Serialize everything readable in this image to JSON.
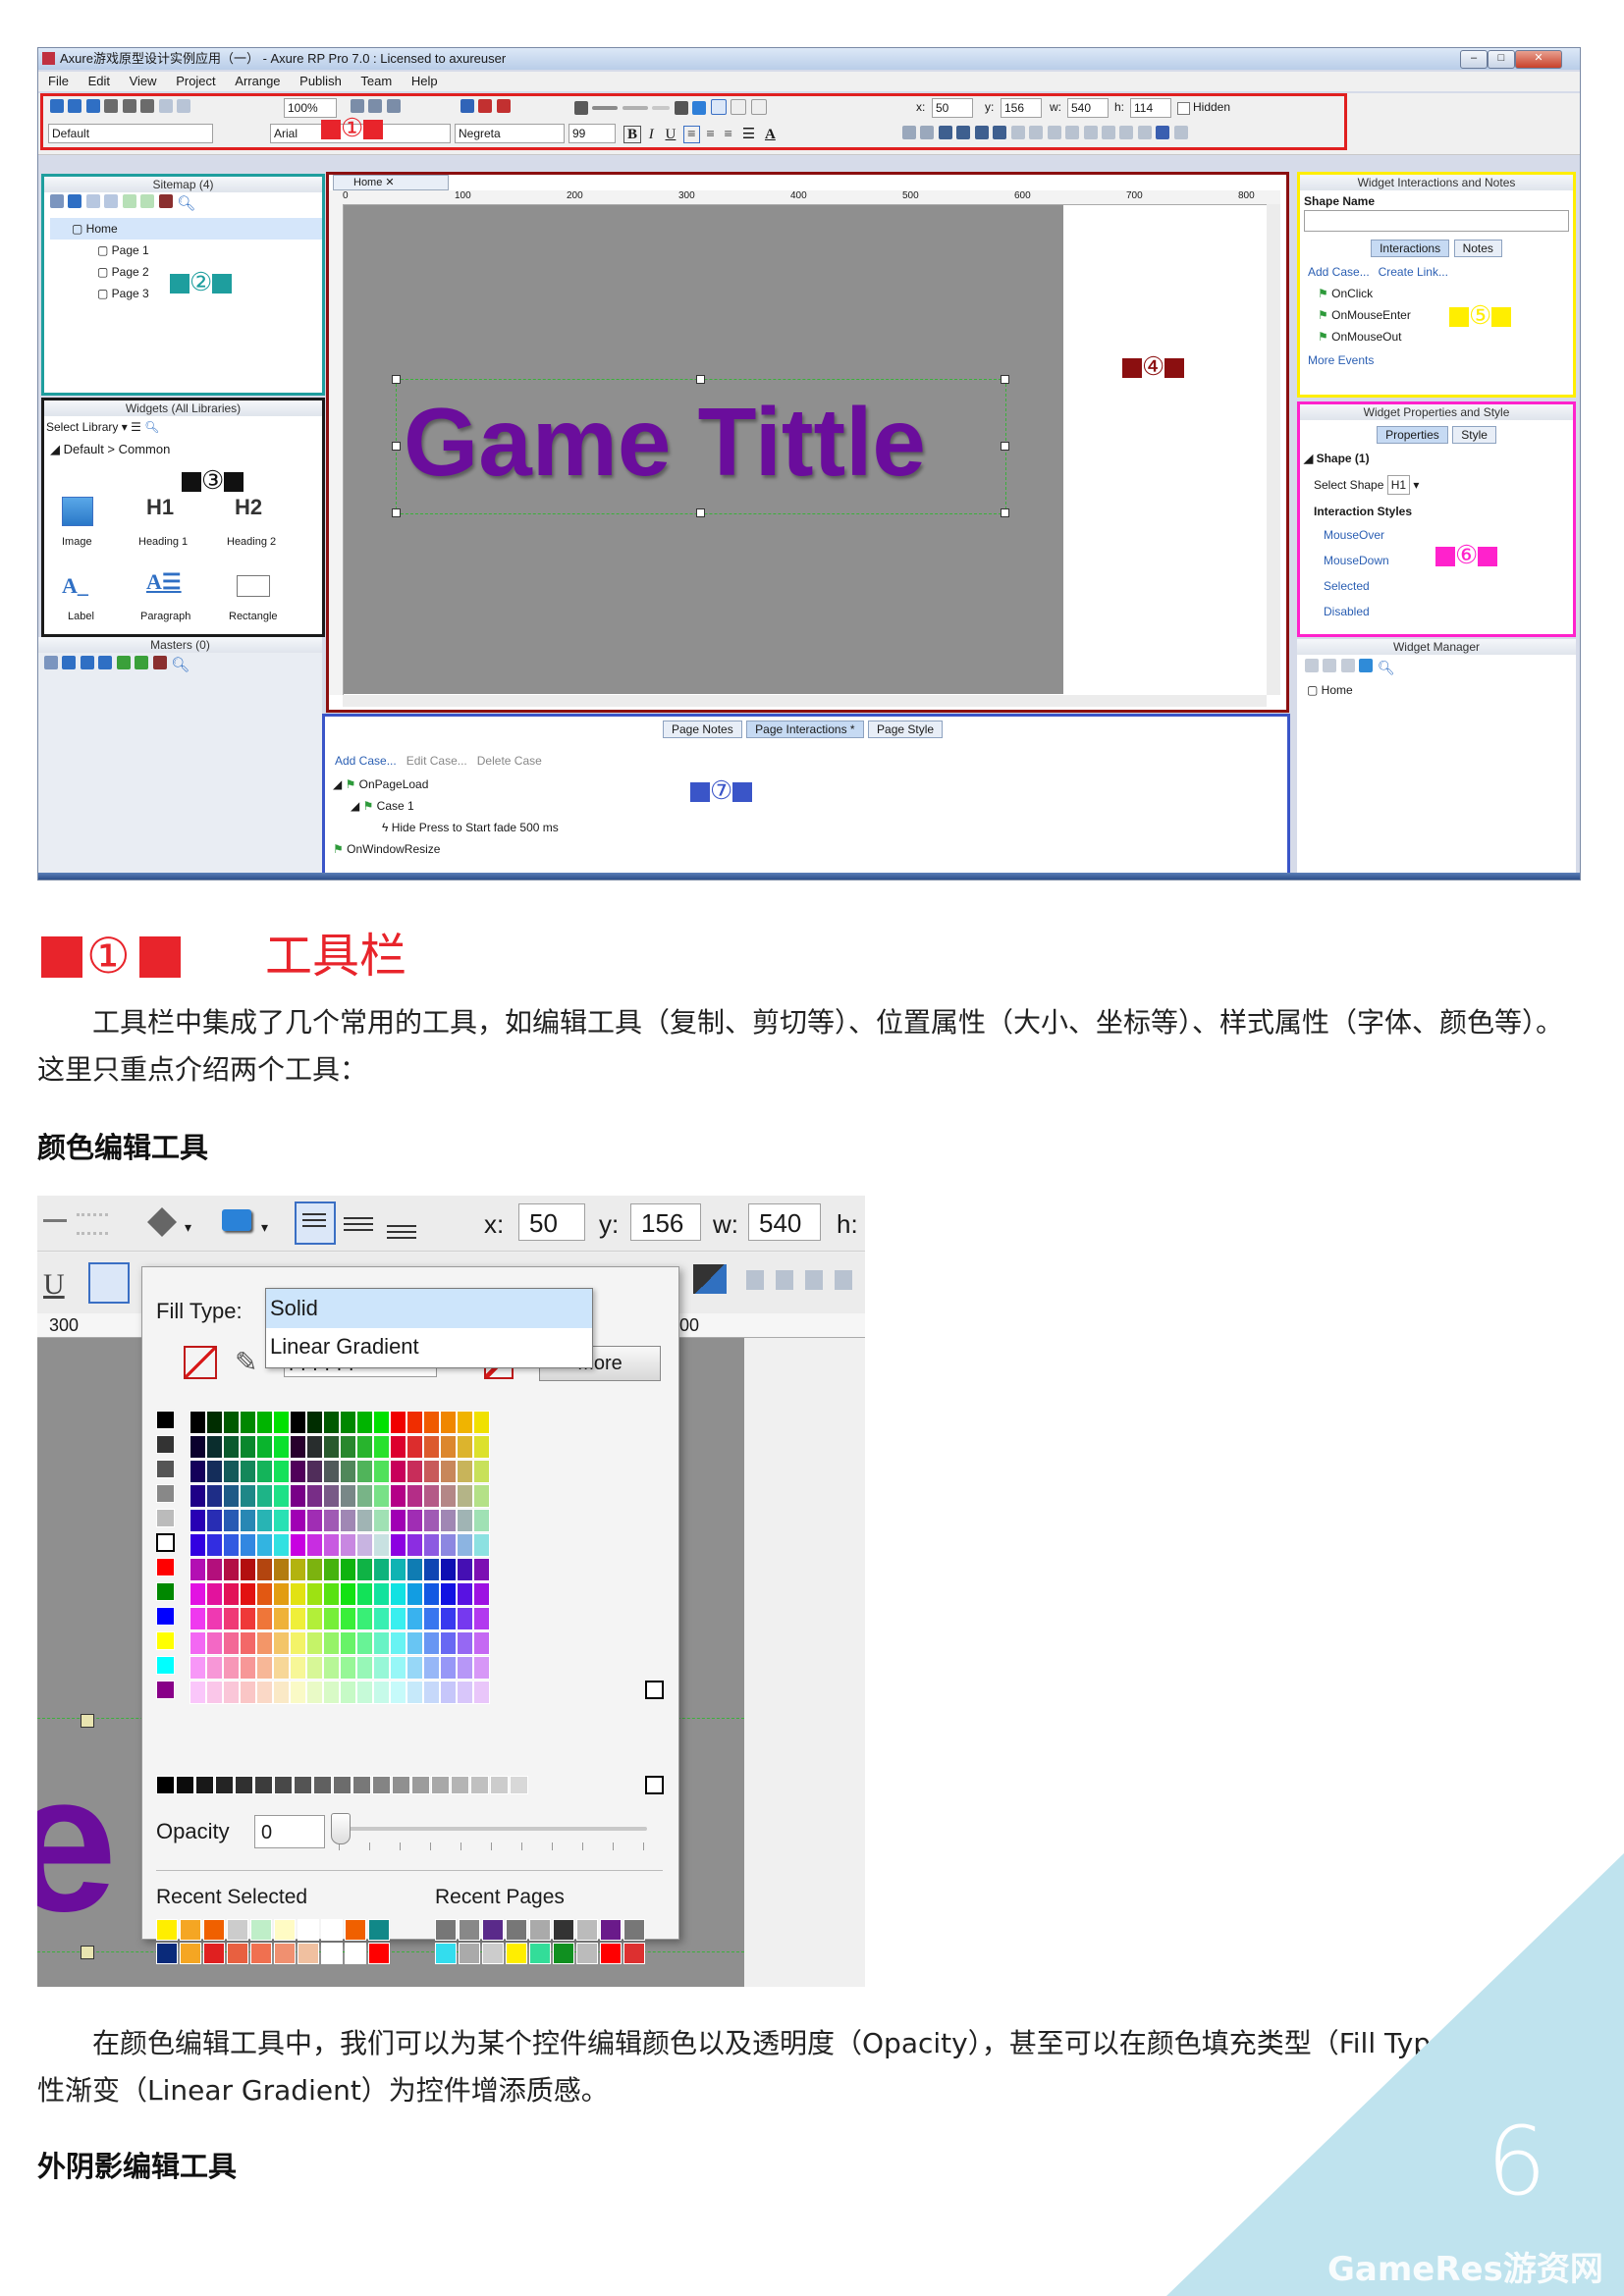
{
  "screenshot1": {
    "title": "Axure游戏原型设计实例应用（一） - Axure RP Pro 7.0 : Licensed to axureuser",
    "menu": [
      "File",
      "Edit",
      "View",
      "Project",
      "Arrange",
      "Publish",
      "Team",
      "Help"
    ],
    "toolbar": {
      "zoom": "100%",
      "x_label": "x:",
      "x_value": "50",
      "y_label": "y:",
      "y_value": "156",
      "w_label": "w:",
      "w_value": "540",
      "h_label": "h:",
      "h_value": "114",
      "hidden_label": "Hidden",
      "style_select": "Default",
      "font_select": "Arial",
      "weight_select": "Negreta",
      "size_select": "99",
      "marker": "①"
    },
    "sitemap": {
      "title": "Sitemap (4)",
      "items": [
        "Home",
        "Page 1",
        "Page 2",
        "Page 3"
      ],
      "marker": "②"
    },
    "widgets": {
      "title": "Widgets (All Libraries)",
      "select_label": "Select Library",
      "group": "Default > Common",
      "marker": "③",
      "items": [
        "Image",
        "Heading 1",
        "Heading 2",
        "Label",
        "Paragraph",
        "Rectangle"
      ],
      "h1_glyph": "H1",
      "h2_glyph": "H2"
    },
    "masters": {
      "title": "Masters (0)"
    },
    "canvas": {
      "tab": "Home",
      "ruler": [
        "0",
        "100",
        "200",
        "300",
        "400",
        "500",
        "600",
        "700",
        "800"
      ],
      "game_title": "Game Tittle",
      "marker": "④"
    },
    "interactions_panel": {
      "title": "Widget Interactions and Notes",
      "shape_name_label": "Shape Name",
      "tab_interactions": "Interactions",
      "tab_notes": "Notes",
      "add_case": "Add Case...",
      "create_link": "Create Link...",
      "events": [
        "OnClick",
        "OnMouseEnter",
        "OnMouseOut"
      ],
      "more_events": "More Events",
      "marker": "⑤"
    },
    "properties_panel": {
      "title": "Widget Properties and Style",
      "tab_properties": "Properties",
      "tab_style": "Style",
      "shape_label": "Shape (1)",
      "select_shape_label": "Select Shape",
      "select_shape_value": "H1",
      "interaction_styles": "Interaction Styles",
      "styles": [
        "MouseOver",
        "MouseDown",
        "Selected",
        "Disabled"
      ],
      "marker": "⑥"
    },
    "widget_manager": {
      "title": "Widget Manager",
      "item": "Home"
    },
    "page_panel": {
      "tab_notes": "Page Notes",
      "tab_interactions": "Page Interactions *",
      "tab_style": "Page Style",
      "add_case": "Add Case...",
      "edit_case": "Edit Case...",
      "delete_case": "Delete Case",
      "tree": [
        "OnPageLoad",
        "Case 1",
        "Hide Press to Start fade 500 ms",
        "OnWindowResize"
      ],
      "marker": "⑦"
    }
  },
  "section": {
    "marker": "①",
    "heading": "工具栏",
    "para1": "工具栏中集成了几个常用的工具，如编辑工具（复制、剪切等）、位置属性（大小、坐标等）、样式属性（字体、颜色等）。这里只重点介绍两个工具：",
    "subhead1": "颜色编辑工具",
    "para2": "在颜色编辑工具中，我们可以为某个控件编辑颜色以及透明度（Opacity），甚至可以在颜色填充类型（Fill Type）中选择线性渐变（Linear Gradient）为控件增添质感。",
    "subhead2": "外阴影编辑工具"
  },
  "screenshot2": {
    "x_label": "x:",
    "x_value": "50",
    "y_label": "y:",
    "y_value": "156",
    "w_label": "w:",
    "w_value": "540",
    "h_label": "h:",
    "fill_type_label": "Fill Type:",
    "fill_options": [
      "Solid",
      "Linear Gradient"
    ],
    "hex_prefix": "#",
    "hex_value": "FFFFFF",
    "more_label": "More",
    "ruler": [
      "300",
      "00"
    ],
    "opacity_label": "Opacity",
    "opacity_value": "0",
    "recent_selected": "Recent Selected",
    "recent_pages": "Recent Pages",
    "canvas_letter": "e"
  },
  "page_number": "6",
  "watermark": "GameRes游资网",
  "colors": {
    "accent_red": "#e8242b",
    "purple": "#6a0d9c",
    "teal": "#1e9e9e",
    "maroon": "#8b0f10",
    "yellow": "#ffee00",
    "magenta": "#ff22cc",
    "blue": "#3a55c8",
    "corner": "#bfe3ee"
  }
}
